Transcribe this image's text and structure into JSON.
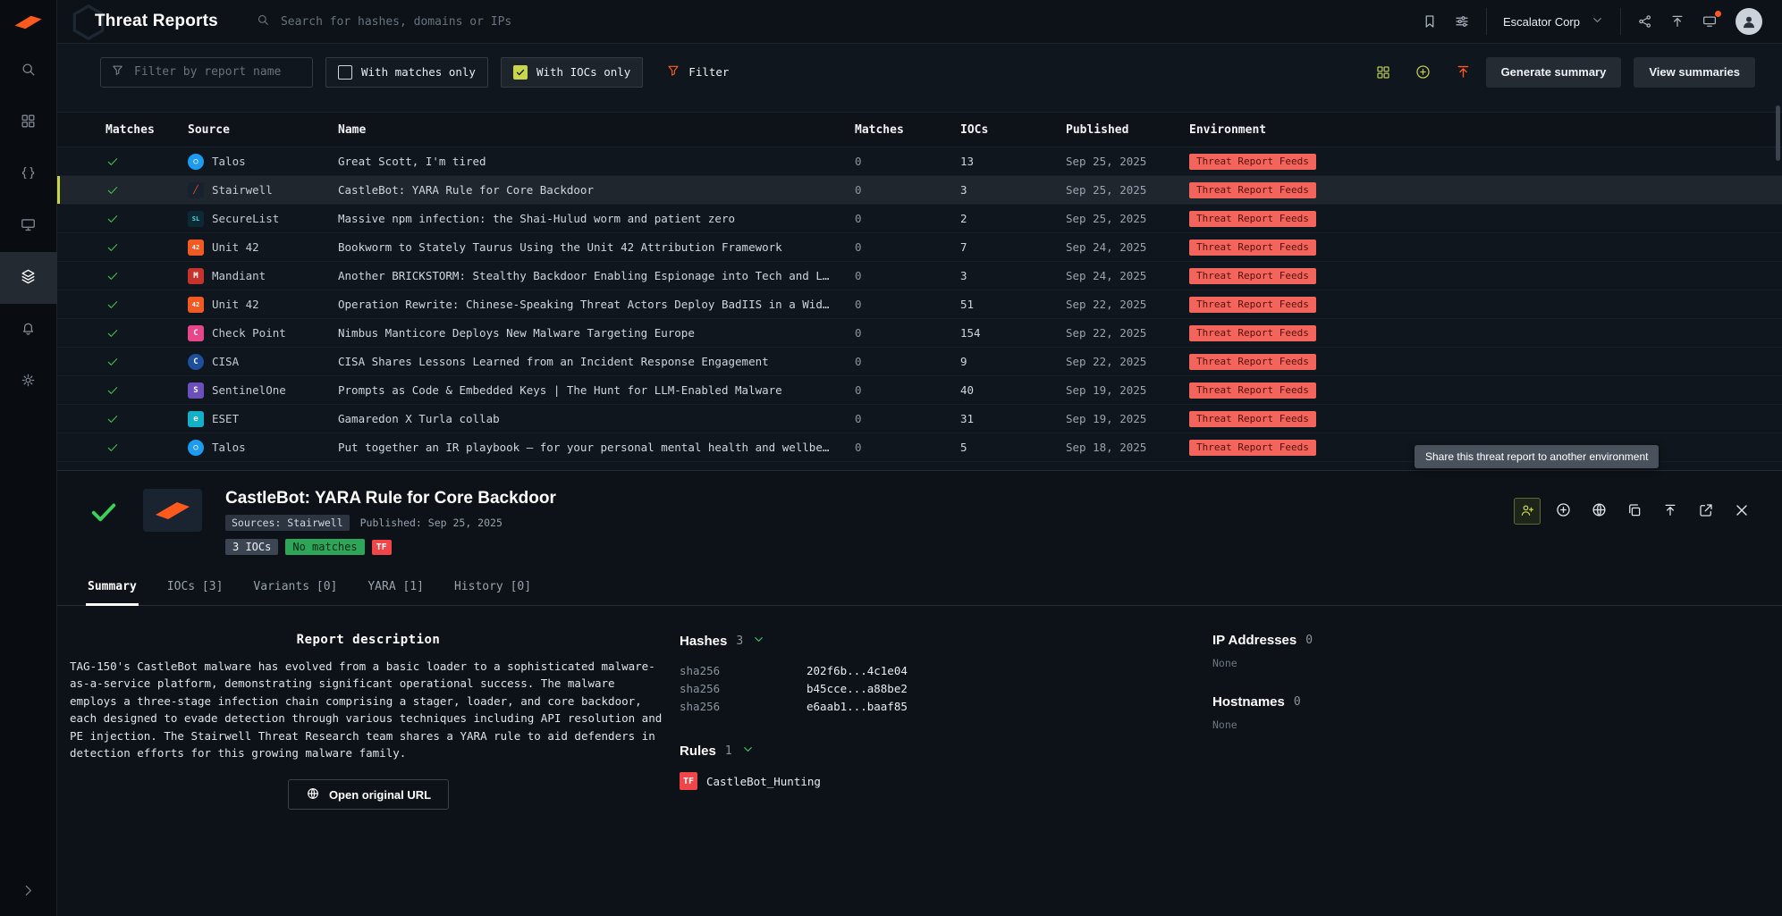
{
  "colors": {
    "accent_orange": "#ff5a1e",
    "accent_lime": "#c9d54a",
    "success_green": "#3fb950",
    "env_badge_bg": "#f3655c",
    "env_badge_text": "#55100b",
    "tf_badge_bg": "#f14649"
  },
  "app": {
    "title": "Threat Reports",
    "search_placeholder": "Search for hashes, domains or IPs",
    "org_name": "Escalator Corp"
  },
  "toolbar": {
    "filter_placeholder": "Filter by report name",
    "with_matches_label": "With matches only",
    "with_iocs_label": "With IOCs only",
    "filter_label": "Filter",
    "generate_summary_label": "Generate summary",
    "view_summaries_label": "View summaries"
  },
  "table": {
    "columns": [
      "Matches",
      "Source",
      "Name",
      "Matches",
      "IOCs",
      "Published",
      "Environment"
    ],
    "rows": [
      {
        "source": "Talos",
        "icon": {
          "name": "talos-logo",
          "glyph": "○",
          "bg": "#1d9bf0",
          "fg": "#ffffff",
          "shape": "circle"
        },
        "name": "Great Scott, I'm tired",
        "matches": "0",
        "iocs": "13",
        "published": "Sep 25, 2025",
        "environment": "Threat Report Feeds"
      },
      {
        "source": "Stairwell",
        "selected": true,
        "icon": {
          "name": "stairwell-logo",
          "glyph": "╱",
          "bg": "#18222e",
          "fg": "#ff5a1e",
          "shape": "square"
        },
        "name": "CastleBot: YARA Rule for Core Backdoor",
        "matches": "0",
        "iocs": "3",
        "published": "Sep 25, 2025",
        "environment": "Threat Report Feeds"
      },
      {
        "source": "SecureList",
        "icon": {
          "name": "securelist-logo",
          "glyph": "SL",
          "bg": "#0c2a33",
          "fg": "#4fd6e8",
          "shape": "square"
        },
        "name": "Massive npm infection: the Shai-Hulud worm and patient zero",
        "matches": "0",
        "iocs": "2",
        "published": "Sep 25, 2025",
        "environment": "Threat Report Feeds"
      },
      {
        "source": "Unit 42",
        "icon": {
          "name": "unit42-logo",
          "glyph": "42",
          "bg": "#f15a22",
          "fg": "#ffffff",
          "shape": "square"
        },
        "name": "Bookworm to Stately Taurus Using the Unit 42 Attribution Framework",
        "matches": "0",
        "iocs": "7",
        "published": "Sep 24, 2025",
        "environment": "Threat Report Feeds"
      },
      {
        "source": "Mandiant",
        "icon": {
          "name": "mandiant-logo",
          "glyph": "M",
          "bg": "#c6332c",
          "fg": "#ffffff",
          "shape": "square"
        },
        "name": "Another BRICKSTORM: Stealthy Backdoor Enabling Espionage into Tech and Lega…",
        "matches": "0",
        "iocs": "3",
        "published": "Sep 24, 2025",
        "environment": "Threat Report Feeds"
      },
      {
        "source": "Unit 42",
        "icon": {
          "name": "unit42-logo",
          "glyph": "42",
          "bg": "#f15a22",
          "fg": "#ffffff",
          "shape": "square"
        },
        "name": "Operation Rewrite: Chinese-Speaking Threat Actors Deploy BadIIS in a Wide S…",
        "matches": "0",
        "iocs": "51",
        "published": "Sep 22, 2025",
        "environment": "Threat Report Feeds"
      },
      {
        "source": "Check Point",
        "icon": {
          "name": "checkpoint-logo",
          "glyph": "C",
          "bg": "#e8468b",
          "fg": "#ffffff",
          "shape": "square"
        },
        "name": "Nimbus Manticore Deploys New Malware Targeting Europe",
        "matches": "0",
        "iocs": "154",
        "published": "Sep 22, 2025",
        "environment": "Threat Report Feeds"
      },
      {
        "source": "CISA",
        "icon": {
          "name": "cisa-logo",
          "glyph": "C",
          "bg": "#1c4f9c",
          "fg": "#ffffff",
          "shape": "circle"
        },
        "name": "CISA Shares Lessons Learned from an Incident Response Engagement",
        "matches": "0",
        "iocs": "9",
        "published": "Sep 22, 2025",
        "environment": "Threat Report Feeds"
      },
      {
        "source": "SentinelOne",
        "icon": {
          "name": "sentinelone-logo",
          "glyph": "S",
          "bg": "#6b4fbb",
          "fg": "#ffffff",
          "shape": "square"
        },
        "name": "Prompts as Code & Embedded Keys | The Hunt for LLM-Enabled Malware",
        "matches": "0",
        "iocs": "40",
        "published": "Sep 19, 2025",
        "environment": "Threat Report Feeds"
      },
      {
        "source": "ESET",
        "icon": {
          "name": "eset-logo",
          "glyph": "e",
          "bg": "#12b0c9",
          "fg": "#ffffff",
          "shape": "square"
        },
        "name": "Gamaredon X Turla collab",
        "matches": "0",
        "iocs": "31",
        "published": "Sep 19, 2025",
        "environment": "Threat Report Feeds"
      },
      {
        "source": "Talos",
        "icon": {
          "name": "talos-logo",
          "glyph": "○",
          "bg": "#1d9bf0",
          "fg": "#ffffff",
          "shape": "circle"
        },
        "name": "Put together an IR playbook — for your personal mental health and wellbeing",
        "matches": "0",
        "iocs": "5",
        "published": "Sep 18, 2025",
        "environment": "Threat Report Feeds"
      }
    ]
  },
  "detail": {
    "title": "CastleBot: YARA Rule for Core Backdoor",
    "sources_label": "Sources: Stairwell",
    "published_label": "Published: Sep 25, 2025",
    "iocs_chip": "3 IOCs",
    "matches_chip": "No matches",
    "env_chip": "TF",
    "tooltip": "Share this threat report to another environment",
    "tabs": [
      {
        "label": "Summary",
        "active": true
      },
      {
        "label": "IOCs [3]"
      },
      {
        "label": "Variants [0]"
      },
      {
        "label": "YARA [1]"
      },
      {
        "label": "History [0]"
      }
    ],
    "description_title": "Report description",
    "description": "TAG-150's CastleBot malware has evolved from a basic loader to a sophisticated malware-as-a-service platform, demonstrating significant operational success. The malware employs a three-stage infection chain comprising a stager, loader, and core backdoor, each designed to evade detection through various techniques including API resolution and PE injection. The Stairwell Threat Research team shares a YARA rule to aid defenders in detection efforts for this growing malware family.",
    "open_url_label": "Open original URL",
    "hashes": {
      "label": "Hashes",
      "count": "3",
      "items": [
        {
          "type": "sha256",
          "value": "202f6b...4c1e04"
        },
        {
          "type": "sha256",
          "value": "b45cce...a88be2"
        },
        {
          "type": "sha256",
          "value": "e6aab1...baaf85"
        }
      ]
    },
    "rules": {
      "label": "Rules",
      "count": "1",
      "items": [
        {
          "tag": "TF",
          "name": "CastleBot_Hunting"
        }
      ]
    },
    "ip_addresses": {
      "label": "IP Addresses",
      "count": "0",
      "empty": "None"
    },
    "hostnames": {
      "label": "Hostnames",
      "count": "0",
      "empty": "None"
    }
  }
}
